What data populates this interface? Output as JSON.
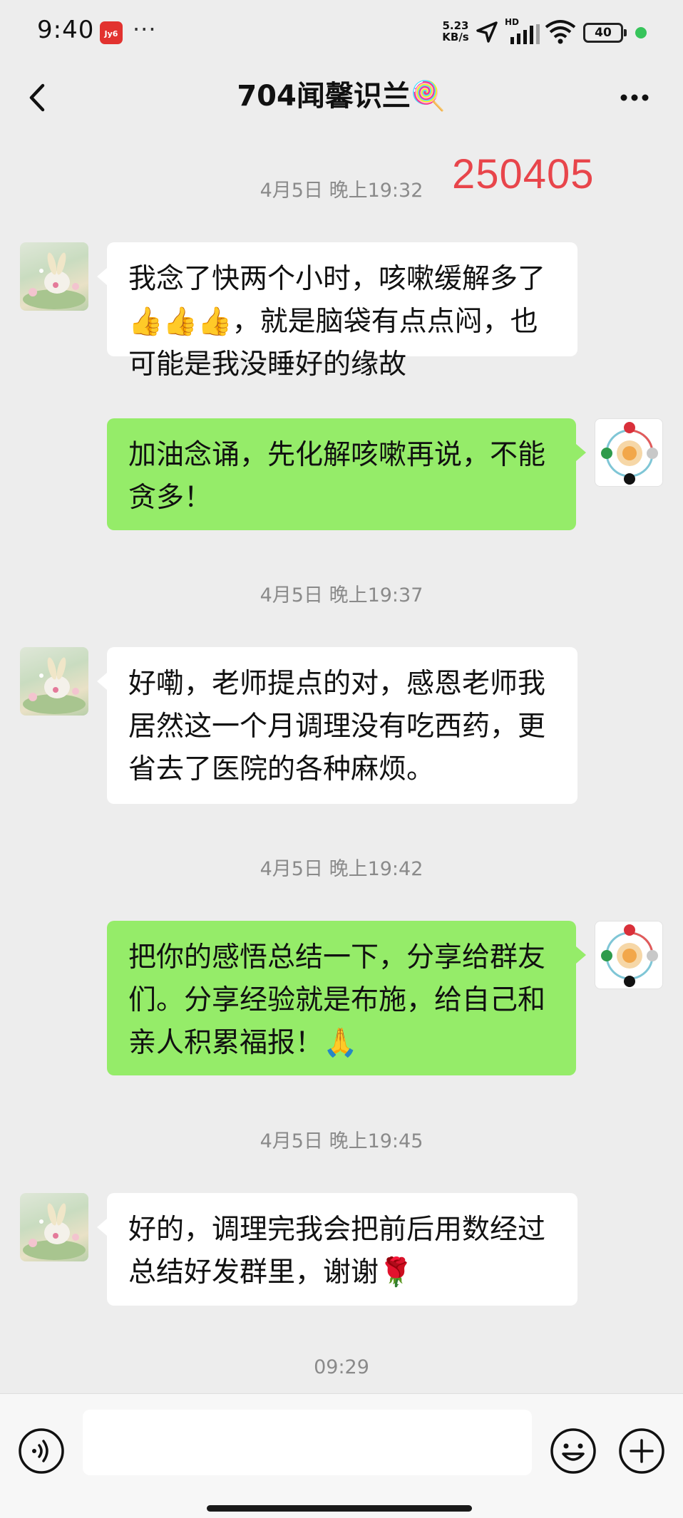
{
  "status_bar": {
    "time": "9:40",
    "app_badge": "Jy6",
    "dots": "···",
    "net_speed_value": "5.23",
    "net_speed_unit": "KB/s",
    "signal_label": "HD",
    "battery": "40",
    "icons": [
      "location-arrow-icon",
      "signal-icon",
      "wifi-icon",
      "battery-icon"
    ]
  },
  "header": {
    "back_icon": "chevron-left-icon",
    "title": "704闻馨识兰🍭",
    "more_icon": "more-dots-icon"
  },
  "overlay_number": "250405",
  "messages": [
    {
      "type": "time",
      "text": "4月5日 晚上19:32"
    },
    {
      "type": "msg",
      "side": "left",
      "text": "我念了快两个小时，咳嗽缓解多了👍👍👍，就是脑袋有点点闷，也可能是我没睡好的缘故"
    },
    {
      "type": "msg",
      "side": "right",
      "text": "加油念诵，先化解咳嗽再说，不能贪多！"
    },
    {
      "type": "time",
      "text": "4月5日 晚上19:37"
    },
    {
      "type": "msg",
      "side": "left",
      "text": "好嘞，老师提点的对，感恩老师我居然这一个月调理没有吃西药，更省去了医院的各种麻烦。"
    },
    {
      "type": "time",
      "text": "4月5日 晚上19:42"
    },
    {
      "type": "msg",
      "side": "right",
      "text": "把你的感悟总结一下，分享给群友们。分享经验就是布施，给自己和亲人积累福报！🙏"
    },
    {
      "type": "time",
      "text": "4月5日 晚上19:45"
    },
    {
      "type": "msg",
      "side": "left",
      "text": "好的，调理完我会把前后用数经过总结好发群里，谢谢🌹"
    },
    {
      "type": "time",
      "text": "09:29"
    }
  ],
  "input_bar": {
    "voice_icon": "voice-icon",
    "placeholder": "",
    "emoji_icon": "emoji-icon",
    "plus_icon": "plus-icon"
  },
  "colors": {
    "background": "#ededed",
    "sent_bubble": "#95ec69",
    "received_bubble": "#ffffff",
    "overlay_red": "#e8454b"
  }
}
